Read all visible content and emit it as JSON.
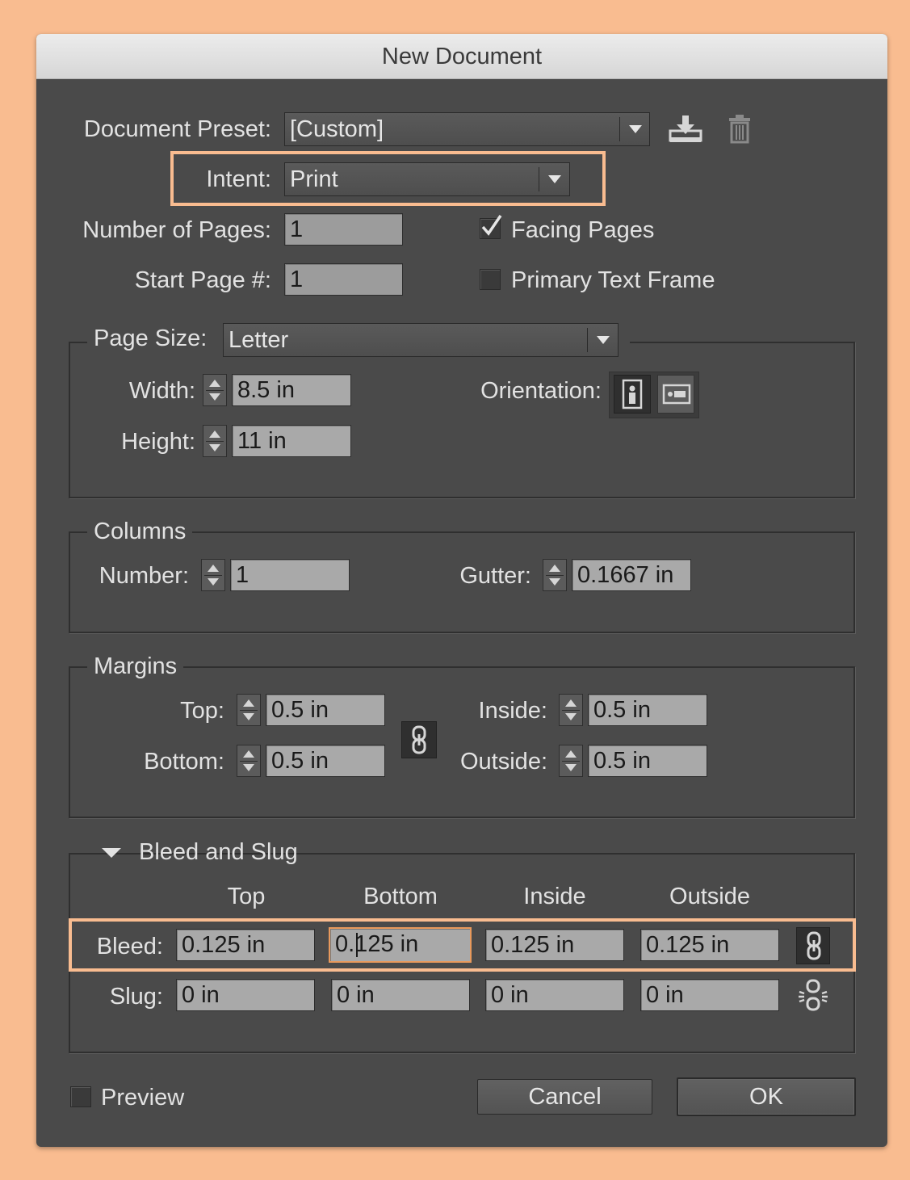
{
  "window": {
    "title": "New Document"
  },
  "preset": {
    "label": "Document Preset:",
    "value": "[Custom]"
  },
  "intent": {
    "label": "Intent:",
    "value": "Print"
  },
  "pages": {
    "count_label": "Number of Pages:",
    "count_value": "1",
    "start_label": "Start Page #:",
    "start_value": "1",
    "facing_label": "Facing Pages",
    "facing_checked": true,
    "primary_label": "Primary Text Frame",
    "primary_checked": false
  },
  "page_size": {
    "label": "Page Size:",
    "value": "Letter",
    "width_label": "Width:",
    "width_value": "8.5 in",
    "height_label": "Height:",
    "height_value": "11 in",
    "orientation_label": "Orientation:",
    "orientation_selected": "portrait"
  },
  "columns": {
    "legend": "Columns",
    "number_label": "Number:",
    "number_value": "1",
    "gutter_label": "Gutter:",
    "gutter_value": "0.1667 in"
  },
  "margins": {
    "legend": "Margins",
    "top_label": "Top:",
    "top_value": "0.5 in",
    "bottom_label": "Bottom:",
    "bottom_value": "0.5 in",
    "inside_label": "Inside:",
    "inside_value": "0.5 in",
    "outside_label": "Outside:",
    "outside_value": "0.5 in"
  },
  "bleed_slug": {
    "legend": "Bleed and Slug",
    "headers": {
      "top": "Top",
      "bottom": "Bottom",
      "inside": "Inside",
      "outside": "Outside"
    },
    "bleed": {
      "label": "Bleed:",
      "top": "0.125 in",
      "bottom": "0.125 in",
      "inside": "0.125 in",
      "outside": "0.125 in"
    },
    "slug": {
      "label": "Slug:",
      "top": "0 in",
      "bottom": "0 in",
      "inside": "0 in",
      "outside": "0 in"
    }
  },
  "footer": {
    "preview_label": "Preview",
    "preview_checked": false,
    "cancel_label": "Cancel",
    "ok_label": "OK"
  },
  "colors": {
    "highlight": "#f9bc90",
    "dialog_bg": "#4a4a4a",
    "field_bg": "#9c9c9c"
  }
}
